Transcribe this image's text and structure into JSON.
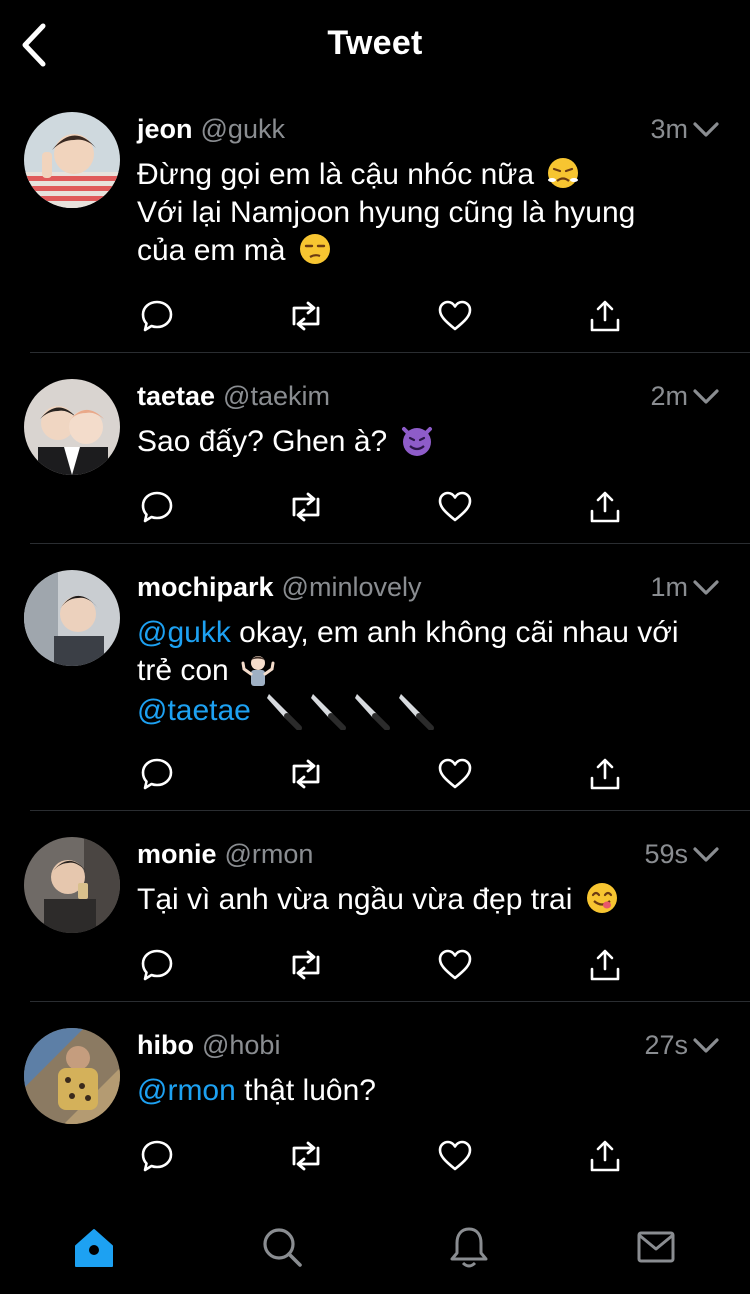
{
  "header": {
    "title": "Tweet",
    "back_icon": "chevron-left-icon"
  },
  "tweets": [
    {
      "name": "jeon",
      "handle": "@gukk",
      "time": "3m",
      "lines": [
        "Đừng gọi em là cậu nhóc nữa",
        "Với lại Namjoon hyung cũng là hyung",
        "của em mà"
      ],
      "emojis": [
        "pouting-face-emoji",
        "unamused-face-emoji"
      ]
    },
    {
      "name": "taetae",
      "handle": "@taekim",
      "time": "2m",
      "lines": [
        "Sao đấy? Ghen à?"
      ],
      "emojis": [
        "smiling-imp-emoji"
      ]
    },
    {
      "name": "mochipark",
      "handle": "@minlovely",
      "time": "1m",
      "mention1": "@gukk",
      "line1_rest": "okay, em anh không cãi nhau với",
      "line2": "trẻ con",
      "mention2": "@taetae",
      "emojis": [
        "person-shrugging-emoji",
        "knife-emoji"
      ]
    },
    {
      "name": "monie",
      "handle": "@rmon",
      "time": "59s",
      "lines": [
        "Tại vì anh vừa ngầu vừa đẹp trai"
      ],
      "emojis": [
        "face-savoring-food-emoji"
      ]
    },
    {
      "name": "hibo",
      "handle": "@hobi",
      "time": "27s",
      "mention": "@rmon",
      "rest": "thật luôn?"
    }
  ],
  "actions": [
    "reply-icon",
    "retweet-icon",
    "like-icon",
    "share-icon"
  ],
  "tabbar": [
    "home-icon",
    "search-icon",
    "notifications-icon",
    "messages-icon"
  ],
  "colors": {
    "accent": "#1da1f2",
    "muted": "#8a8d91",
    "background": "#000000"
  }
}
